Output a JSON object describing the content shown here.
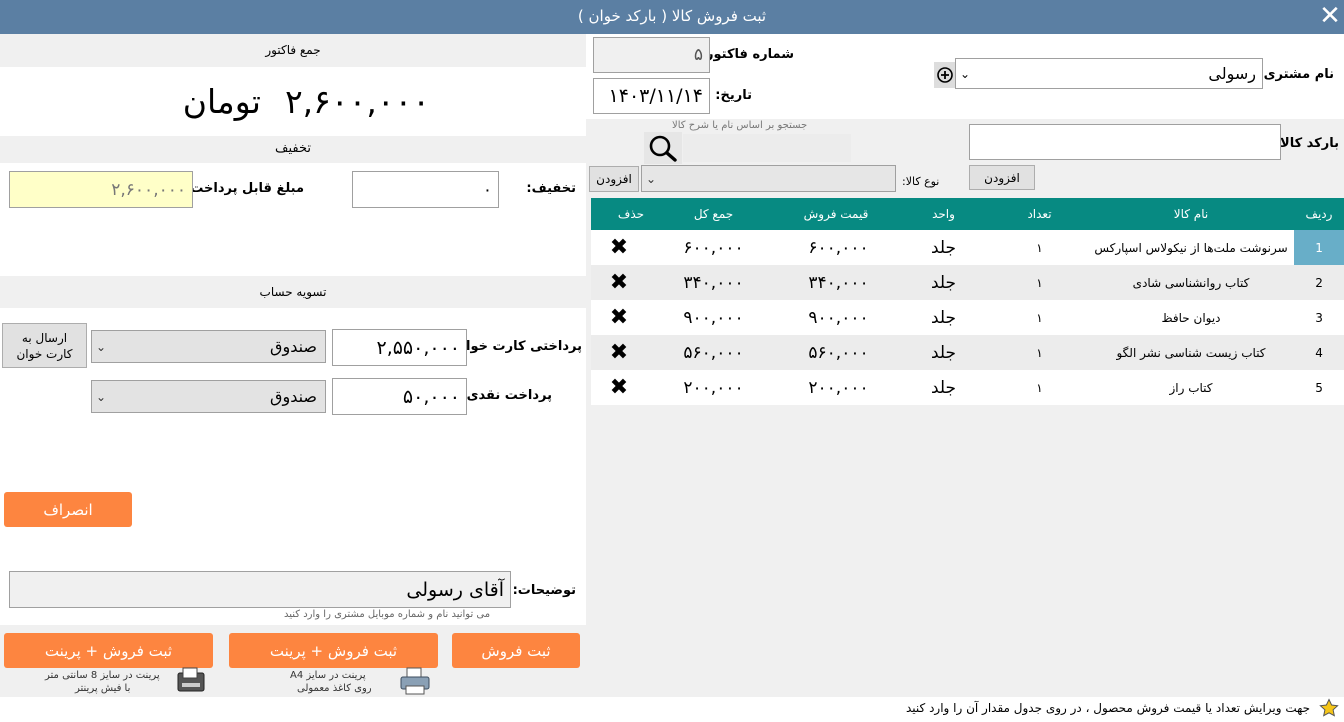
{
  "window": {
    "title": "ثبت فروش کالا ( بارکد خوان )",
    "close_glyph": "✕"
  },
  "header": {
    "customer_label": "نام مشتری:",
    "customer_value": "رسولی",
    "invoice_no_label": "شماره فاکتور:",
    "invoice_no_value": "۵",
    "date_label": "تاریخ:",
    "date_value": "۱۴۰۳/۱۱/۱۴"
  },
  "product_entry": {
    "barcode_label": "بارکد کالا:",
    "barcode_value": "",
    "search_hint": "جستجو بر اساس نام یا شرح کالا",
    "search_value": "",
    "type_label": "نوع کالا:",
    "type_value": "",
    "add_label_1": "افزودن",
    "add_label_2": "افزودن"
  },
  "table": {
    "headers": [
      "ردیف",
      "نام کالا",
      "تعداد",
      "واحد",
      "قیمت فروش",
      "جمع کل",
      "حذف"
    ],
    "rows": [
      {
        "n": "1",
        "name": "سرنوشت ملت‌ها از نیکولاس اسپارکس",
        "qty": "۱",
        "unit": "جلد",
        "price": "۶۰۰,۰۰۰",
        "total": "۶۰۰,۰۰۰",
        "del": "✖"
      },
      {
        "n": "2",
        "name": "کتاب روانشناسی شادی",
        "qty": "۱",
        "unit": "جلد",
        "price": "۳۴۰,۰۰۰",
        "total": "۳۴۰,۰۰۰",
        "del": "✖"
      },
      {
        "n": "3",
        "name": "دیوان حافظ",
        "qty": "۱",
        "unit": "جلد",
        "price": "۹۰۰,۰۰۰",
        "total": "۹۰۰,۰۰۰",
        "del": "✖"
      },
      {
        "n": "4",
        "name": "کتاب زیست شناسی نشر الگو",
        "qty": "۱",
        "unit": "جلد",
        "price": "۵۶۰,۰۰۰",
        "total": "۵۶۰,۰۰۰",
        "del": "✖"
      },
      {
        "n": "5",
        "name": "کتاب راز",
        "qty": "۱",
        "unit": "جلد",
        "price": "۲۰۰,۰۰۰",
        "total": "۲۰۰,۰۰۰",
        "del": "✖"
      }
    ]
  },
  "summary": {
    "section_title": "جمع فاکتور",
    "total_amount": "۲,۶۰۰,۰۰۰",
    "currency": "تومان",
    "discount_section": "تخفیف",
    "discount_label": "تخفیف:",
    "discount_value": "۰",
    "payable_label": "مبلغ قابل پرداخت:",
    "payable_value": "۲,۶۰۰,۰۰۰"
  },
  "settlement": {
    "section_title": "تسویه حساب",
    "card_label": "پرداختی کارت خوان:",
    "card_value": "۲,۵۵۰,۰۰۰",
    "card_account": "صندوق",
    "send_card_label_1": "ارسال به",
    "send_card_label_2": "کارت خوان",
    "cash_label": "پرداخت نقدی:",
    "cash_value": "۵۰,۰۰۰",
    "cash_account": "صندوق",
    "cancel_label": "انصراف"
  },
  "notes": {
    "label": "توضیحات:",
    "value": "آقای رسولی",
    "hint": "می توانید نام و شماره موبایل مشتری را وارد کنید"
  },
  "actions": {
    "save_label": "ثبت فروش",
    "save_print_a4_label": "ثبت فروش + پرینت",
    "save_print_a4_hint_1": "پرینت در سایز A4",
    "save_print_a4_hint_2": "روی کاغذ معمولی",
    "save_print_receipt_label": "ثبت فروش + پرینت",
    "save_print_receipt_hint_1": "پرینت در سایز 8 سانتی متر",
    "save_print_receipt_hint_2": "با فیش پرینتر"
  },
  "status": {
    "tip": "جهت ویرایش تعداد یا قیمت فروش محصول ، در روی جدول مقدار آن را وارد کنید"
  },
  "colors": {
    "titlebar": "#5b7fa3",
    "grid_header": "#078a82",
    "selected_cell": "#68aec8",
    "accent_button": "#fd8540"
  }
}
